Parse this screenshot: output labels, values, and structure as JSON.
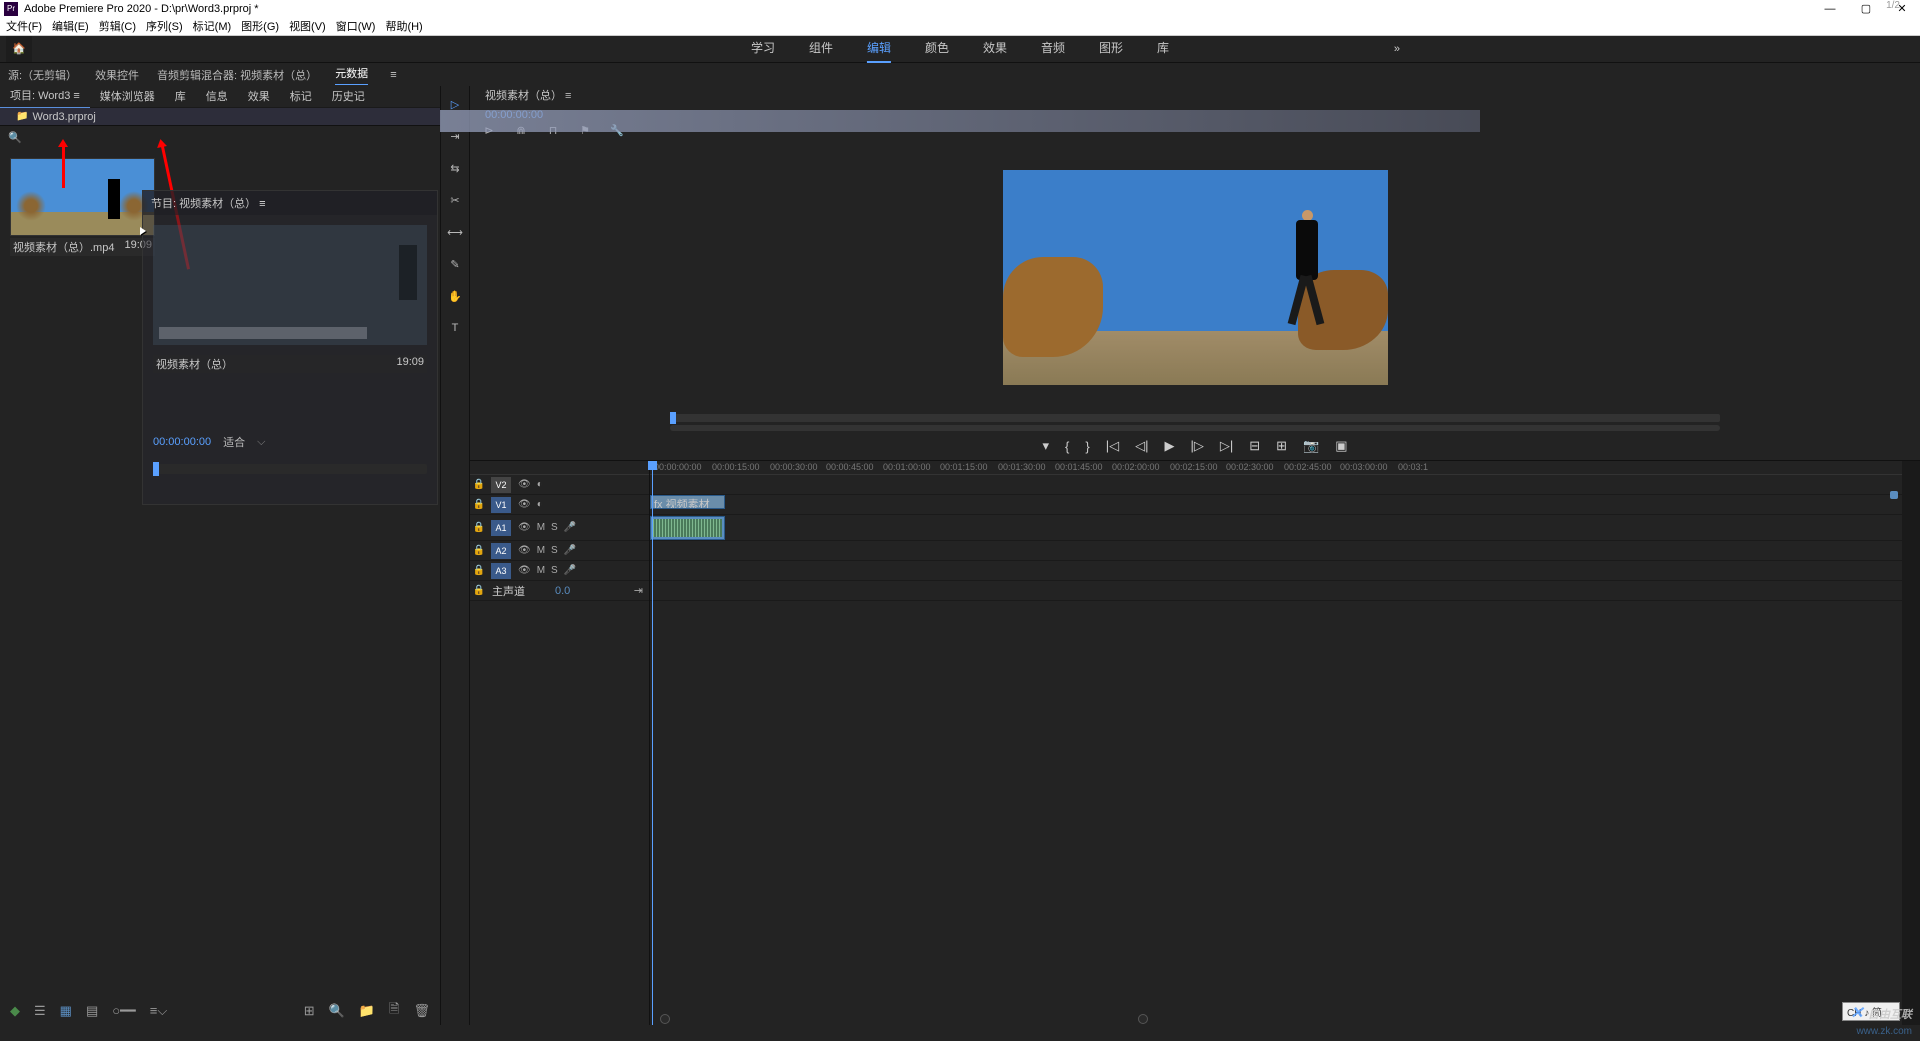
{
  "title": "Adobe Premiere Pro 2020 - D:\\pr\\Word3.prproj *",
  "menus": {
    "file": "文件(F)",
    "edit": "编辑(E)",
    "clip": "剪辑(C)",
    "sequence": "序列(S)",
    "marker": "标记(M)",
    "graphics": "图形(G)",
    "view": "视图(V)",
    "window": "窗口(W)",
    "help": "帮助(H)"
  },
  "workspaces": {
    "learn": "学习",
    "assembly": "组件",
    "edit": "编辑",
    "color": "颜色",
    "effects": "效果",
    "audio": "音频",
    "graphics": "图形",
    "library": "库"
  },
  "source_tabs": {
    "none": "源:（无剪辑）",
    "effect_ctrl": "效果控件",
    "audio_mixer": "音频剪辑混合器: 视频素材（总）",
    "metadata": "元数据"
  },
  "project_tabs": {
    "project": "项目: Word3",
    "media": "媒体浏览器",
    "lib": "库",
    "info": "信息",
    "effects": "效果",
    "marker": "标记",
    "history": "历史记"
  },
  "project_file": "Word3.prproj",
  "clips": [
    {
      "name": "视频素材（总）.mp4",
      "dur": "19:09"
    },
    {
      "name": "视频素材（总）",
      "dur": "19:09"
    }
  ],
  "src_monitor": {
    "title": "节目: 视频素材（总）",
    "tc": "00:00:00:00",
    "fit": "适合"
  },
  "program": {
    "title": "视频素材（总）",
    "tc": "00:00:00:00",
    "page": "1/2"
  },
  "timeline_ticks": [
    "00:00:00:00",
    "00:00:15:00",
    "00:00:30:00",
    "00:00:45:00",
    "00:01:00:00",
    "00:01:15:00",
    "00:01:30:00",
    "00:01:45:00",
    "00:02:00:00",
    "00:02:15:00",
    "00:02:30:00",
    "00:02:45:00",
    "00:03:00:00",
    "00:03:1"
  ],
  "tracks": {
    "v2": "V2",
    "v1": "V1",
    "a1": "A1",
    "a2": "A2",
    "a3": "A3",
    "master": "主声道",
    "master_val": "0.0",
    "m": "M",
    "s": "S"
  },
  "clip_in_tl": "fx 视频素材（…",
  "watermark": "自由互联",
  "watermark2": "www.zk.com",
  "ime": "CH ♪ 简"
}
